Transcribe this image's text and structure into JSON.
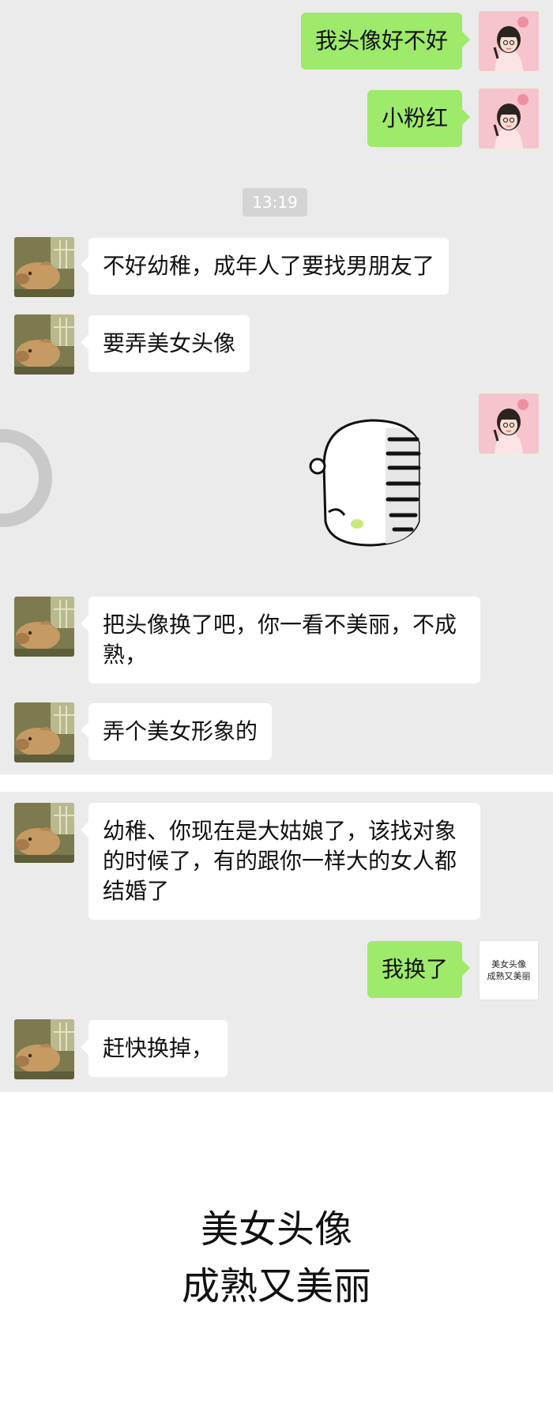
{
  "chat": {
    "timestamp": "13:19",
    "messages": [
      {
        "side": "right",
        "text": "我头像好不好"
      },
      {
        "side": "right",
        "text": "小粉红"
      },
      {
        "side": "left",
        "text": "不好幼稚，成年人了要找男朋友了"
      },
      {
        "side": "left",
        "text": "要弄美女头像"
      },
      {
        "side": "right",
        "type": "sticker",
        "icon": "cartoon-blob-sticker"
      },
      {
        "side": "left",
        "text": "把头像换了吧，你一看不美丽，不成熟，"
      },
      {
        "side": "left",
        "text": "弄个美女形象的"
      },
      {
        "side": "left",
        "text": "幼稚、你现在是大姑娘了，该找对象的时候了，有的跟你一样大的女人都结婚了"
      },
      {
        "side": "right",
        "text": "我换了"
      },
      {
        "side": "left",
        "text": "赶快换掉，"
      }
    ],
    "new_avatar": {
      "line1": "美女头像",
      "line2": "成熟又美丽"
    }
  },
  "caption": {
    "line1": "美女头像",
    "line2": "成熟又美丽"
  },
  "colors": {
    "background": "#ebebeb",
    "bubble_self": "#9eea6a",
    "bubble_other": "#ffffff",
    "timestamp_bg": "#d4d4d4"
  }
}
